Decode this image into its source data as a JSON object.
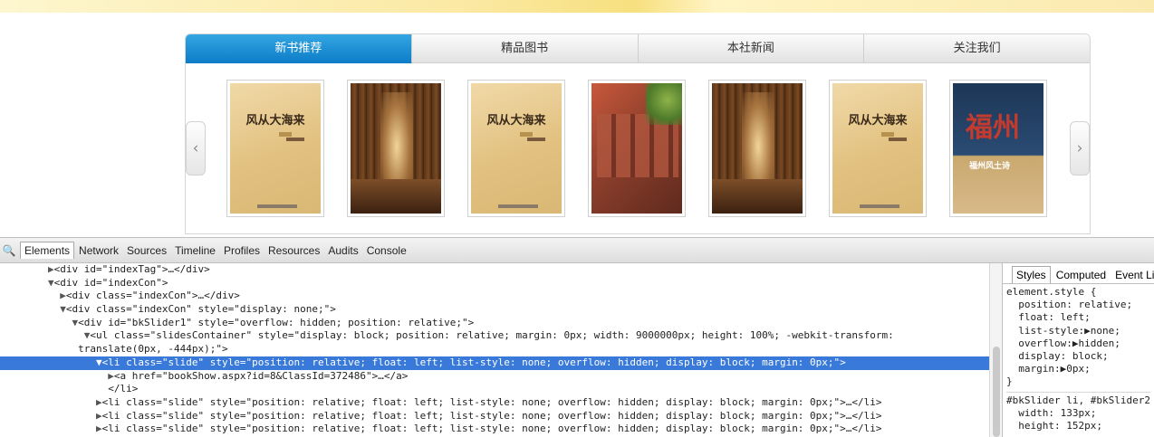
{
  "tabs": [
    "新书推荐",
    "精品图书",
    "本社新闻",
    "关注我们"
  ],
  "slider": {
    "prev_glyph": "‹",
    "next_glyph": "›",
    "slides": [
      {
        "kind": "tan",
        "title": "风从大海来"
      },
      {
        "kind": "library"
      },
      {
        "kind": "tan",
        "title": "风从大海来"
      },
      {
        "kind": "red"
      },
      {
        "kind": "library"
      },
      {
        "kind": "tan",
        "title": "风从大海来"
      },
      {
        "kind": "navy",
        "title": "福州",
        "subtitle": "福州风土诗"
      }
    ]
  },
  "devtools": {
    "search_glyph": "🔍",
    "tabs": [
      "Elements",
      "Network",
      "Sources",
      "Timeline",
      "Profiles",
      "Resources",
      "Audits",
      "Console"
    ],
    "dom_lines": [
      {
        "indent": "        ",
        "tri": "▶",
        "text": "<div id=\"indexTag\">…</div>"
      },
      {
        "indent": "        ",
        "tri": "▼",
        "text": "<div id=\"indexCon\">"
      },
      {
        "indent": "          ",
        "tri": "▶",
        "text": "<div class=\"indexCon\">…</div>"
      },
      {
        "indent": "          ",
        "tri": "▼",
        "text": "<div class=\"indexCon\" style=\"display: none;\">"
      },
      {
        "indent": "            ",
        "tri": "▼",
        "text": "<div id=\"bkSlider1\" style=\"overflow: hidden; position: relative;\">"
      },
      {
        "indent": "              ",
        "tri": "▼",
        "text": "<ul class=\"slidesContainer\" style=\"display: block; position: relative; margin: 0px; width: 9000000px; height: 100%; -webkit-transform:"
      },
      {
        "indent": "             ",
        "tri": "",
        "text": "translate(0px, -444px);\">"
      },
      {
        "indent": "                ",
        "tri": "▼",
        "text": "<li class=\"slide\" style=\"position: relative; float: left; list-style: none; overflow: hidden; display: block; margin: 0px;\">",
        "selected": true
      },
      {
        "indent": "                  ",
        "tri": "▶",
        "text": "<a href=\"bookShow.aspx?id=8&ClassId=372486\">…</a>"
      },
      {
        "indent": "                ",
        "tri": "",
        "text": "  </li>"
      },
      {
        "indent": "                ",
        "tri": "▶",
        "text": "<li class=\"slide\" style=\"position: relative; float: left; list-style: none; overflow: hidden; display: block; margin: 0px;\">…</li>"
      },
      {
        "indent": "                ",
        "tri": "▶",
        "text": "<li class=\"slide\" style=\"position: relative; float: left; list-style: none; overflow: hidden; display: block; margin: 0px;\">…</li>"
      },
      {
        "indent": "                ",
        "tri": "▶",
        "text": "<li class=\"slide\" style=\"position: relative; float: left; list-style: none; overflow: hidden; display: block; margin: 0px;\">…</li>"
      }
    ],
    "side_tabs": [
      "Styles",
      "Computed",
      "Event Lis"
    ],
    "styles": [
      "element.style {",
      "  position: relative;",
      "  float: left;",
      "  list-style:▶none;",
      "  overflow:▶hidden;",
      "  display: block;",
      "  margin:▶0px;",
      "}",
      "---",
      "#bkSlider li, #bkSlider2",
      "  width: 133px;",
      "  height: 152px;"
    ]
  }
}
